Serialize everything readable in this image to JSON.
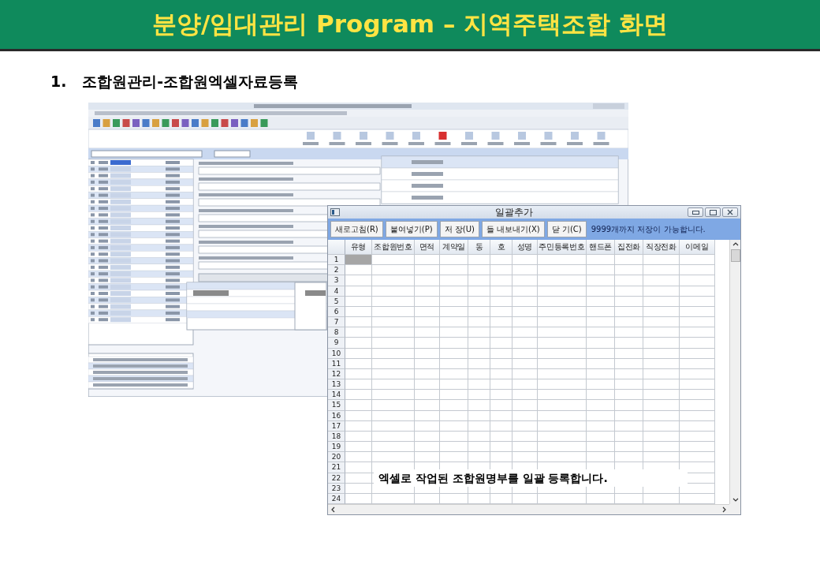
{
  "header": {
    "title": "분양/임대관리 Program – 지역주택조합 화면"
  },
  "section_title": "1.   조합원관리-조합원엑셀자료등록",
  "dialog": {
    "title": "일괄추가",
    "buttons": [
      "새로고침(R)",
      "붙여넣기(P)",
      "저 장(U)",
      "들 내보내기(X)",
      "닫 기(C)"
    ],
    "message": "9999개까지 저장이 가능합니다.",
    "columns": [
      "유형",
      "조합원번호",
      "면적",
      "계약일",
      "동",
      "호",
      "성명",
      "주민등록번호",
      "핸드폰",
      "집전화",
      "직장전화",
      "이메일"
    ],
    "rows": [
      {
        "number": "1",
        "selected": true
      },
      {
        "number": "2",
        "selected": false
      },
      {
        "number": "3",
        "selected": false
      },
      {
        "number": "4",
        "selected": false
      },
      {
        "number": "5",
        "selected": false
      },
      {
        "number": "6",
        "selected": false
      },
      {
        "number": "7",
        "selected": false
      },
      {
        "number": "8",
        "selected": false
      },
      {
        "number": "9",
        "selected": false
      },
      {
        "number": "10",
        "selected": false
      },
      {
        "number": "11",
        "selected": false
      },
      {
        "number": "12",
        "selected": false
      },
      {
        "number": "13",
        "selected": false
      },
      {
        "number": "14",
        "selected": false
      },
      {
        "number": "15",
        "selected": false
      },
      {
        "number": "16",
        "selected": false
      },
      {
        "number": "17",
        "selected": false
      },
      {
        "number": "18",
        "selected": false
      },
      {
        "number": "19",
        "selected": false
      },
      {
        "number": "20",
        "selected": false
      },
      {
        "number": "21",
        "selected": false
      },
      {
        "number": "22",
        "selected": false
      },
      {
        "number": "23",
        "selected": false
      },
      {
        "number": "24",
        "selected": false
      }
    ],
    "callout": "엑셀로 작업된 조합원명부를 일괄 등록합니다."
  }
}
